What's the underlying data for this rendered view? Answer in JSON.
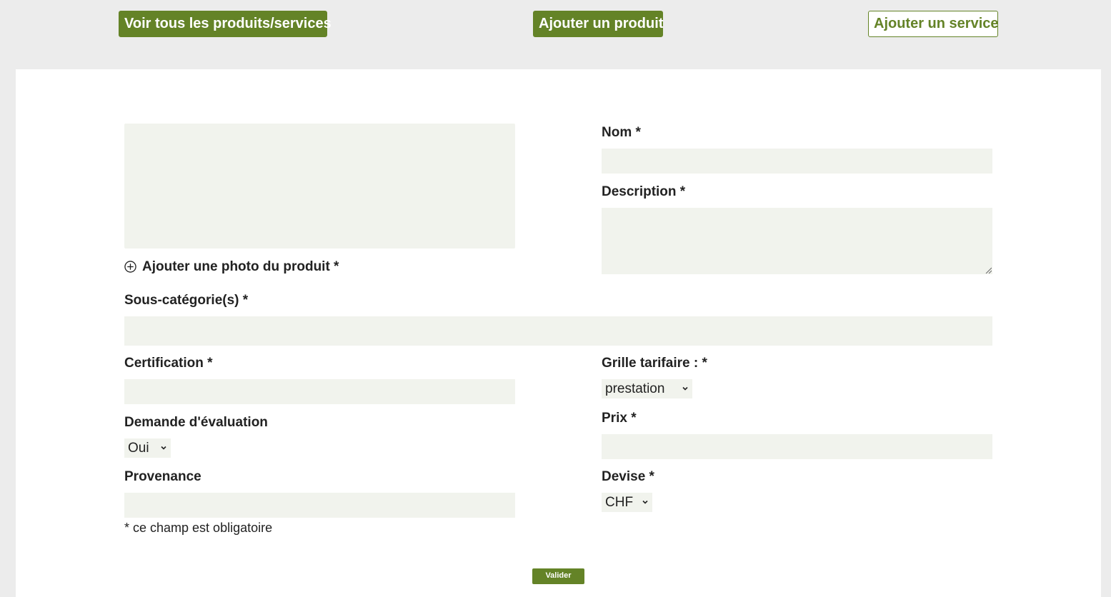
{
  "header": {
    "view_all_label": "Voir tous les produits/services",
    "add_product_label": "Ajouter un produit",
    "add_service_label": "Ajouter un service"
  },
  "form": {
    "name_label": "Nom *",
    "name_value": "",
    "description_label": "Description *",
    "description_value": "",
    "add_photo_label": "Ajouter une photo du produit *",
    "subcategories_label": "Sous-catégorie(s) *",
    "subcategories_value": "",
    "certification_label": "Certification *",
    "certification_value": "",
    "evaluation_label": "Demande d'évaluation",
    "evaluation_selected": "Oui",
    "provenance_label": "Provenance",
    "provenance_value": "",
    "pricing_label": "Grille tarifaire : *",
    "pricing_selected": "prestation",
    "price_label": "Prix *",
    "price_value": "",
    "currency_label": "Devise *",
    "currency_selected": "CHF",
    "required_note": "* ce champ est obligatoire",
    "submit_label": "Valider"
  },
  "icons": {
    "add_photo": "plus-circle-icon",
    "dropdown": "chevron-down-icon"
  },
  "colors": {
    "accent": "#648327",
    "field_background": "#f1f3ed",
    "page_background": "#ececec"
  }
}
